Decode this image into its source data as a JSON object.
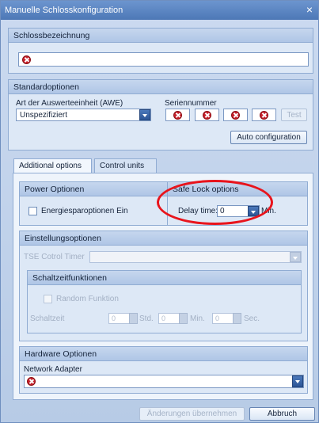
{
  "window": {
    "title": "Manuelle Schlosskonfiguration",
    "close_glyph": "×"
  },
  "lock_name": {
    "header": "Schlossbezeichnung",
    "value": ""
  },
  "standard": {
    "header": "Standardoptionen",
    "awe_label": "Art der Auswerteeinheit (AWE)",
    "awe_value": "Unspezifiziert",
    "serial_label": "Seriennummer",
    "serial_ok_label": "Test",
    "auto_config_label": "Auto configuration"
  },
  "tabs": [
    {
      "label": "Additional options"
    },
    {
      "label": "Control units"
    }
  ],
  "power": {
    "header": "Power Optionen",
    "energy_label": "Energiesparoptionen Ein"
  },
  "safe_lock": {
    "header": "Safe Lock options",
    "delay_label": "Delay time:",
    "delay_value": "0",
    "unit": "Min."
  },
  "settings": {
    "header": "Einstellungsoptionen",
    "tse_label": "TSE Cotrol Timer",
    "switch": {
      "header": "Schaltzeitfunktionen",
      "random_label": "Random Funktion",
      "time_label": "Schaltzeit",
      "hours_value": "0",
      "hours_unit": "Std.",
      "minutes_value": "0",
      "minutes_unit": "Min.",
      "seconds_value": "0",
      "seconds_unit": "Sec."
    }
  },
  "hardware": {
    "header": "Hardware Optionen",
    "adapter_label": "Network Adapter",
    "adapter_value": ""
  },
  "footer": {
    "apply_label": "Änderungen übernehmen",
    "cancel_label": "Abbruch"
  }
}
